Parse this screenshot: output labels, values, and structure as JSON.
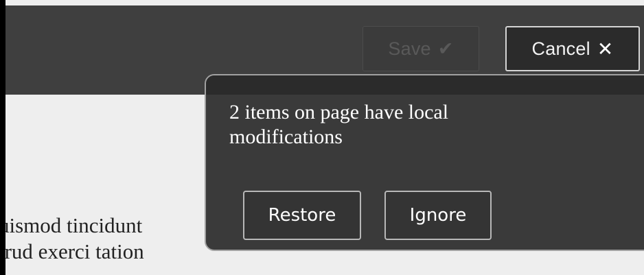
{
  "toolbar": {
    "save_label": "Save",
    "save_icon": "✔",
    "cancel_label": "Cancel",
    "cancel_icon": "✕"
  },
  "page": {
    "body_lines": [
      "uismod tincidunt",
      "trud exerci tation"
    ]
  },
  "notice": {
    "message_lines": [
      "2 items on page have local",
      "modifications"
    ],
    "restore_label": "Restore",
    "ignore_label": "Ignore"
  },
  "colors": {
    "toolbar_bg": "#3f3f3f",
    "popover_bg": "#3a3a3a",
    "page_bg": "#eeeeee",
    "text_light": "#ffffff",
    "text_muted": "#595959"
  }
}
